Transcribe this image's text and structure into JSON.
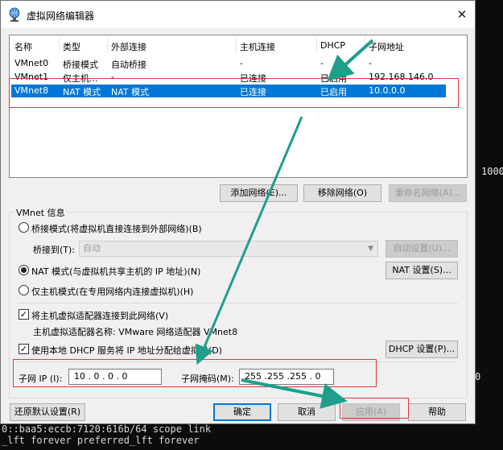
{
  "window": {
    "title": "虚拟网络编辑器",
    "close_glyph": "✕"
  },
  "columns": [
    "名称",
    "类型",
    "外部连接",
    "主机连接",
    "DHCP",
    "子网地址"
  ],
  "rows": [
    {
      "name": "VMnet0",
      "type": "桥接模式",
      "external": "自动桥接",
      "host": "-",
      "dhcp": "-",
      "subnet": "-"
    },
    {
      "name": "VMnet1",
      "type": "仅主机...",
      "external": "-",
      "host": "已连接",
      "dhcp": "已启用",
      "subnet": "192.168.146.0"
    },
    {
      "name": "VMnet8",
      "type": "NAT 模式",
      "external": "NAT 模式",
      "host": "已连接",
      "dhcp": "已启用",
      "subnet": "10.0.0.0"
    }
  ],
  "list_buttons": {
    "add": "添加网络(E)...",
    "remove": "移除网络(O)",
    "rename": "重命名网络(A)..."
  },
  "vmnet_info": {
    "group_label": "VMnet 信息",
    "bridged_radio": "桥接模式(将虚拟机直接连接到外部网络)(B)",
    "bridged_to_label": "桥接到(T):",
    "bridged_to_value": "自动",
    "auto_settings": "自动设置(U)...",
    "nat_radio": "NAT 模式(与虚拟机共享主机的 IP 地址)(N)",
    "nat_settings": "NAT 设置(S)...",
    "hostonly_radio": "仅主机模式(在专用网络内连接虚拟机)(H)",
    "connect_adapter_check": "将主机虚拟适配器连接到此网络(V)",
    "adapter_name": "主机虚拟适配器名称: VMware 网络适配器 VMnet8",
    "dhcp_check": "使用本地 DHCP 服务将 IP 地址分配给虚拟机(D)",
    "dhcp_settings": "DHCP 设置(P)...",
    "subnet_ip_label": "子网 IP (I):",
    "subnet_ip_value": "10 . 0 . 0 . 0",
    "subnet_mask_label": "子网掩码(M):",
    "subnet_mask_value": "255 .255 .255 . 0"
  },
  "footer": {
    "restore": "还原默认设置(R)",
    "ok": "确定",
    "cancel": "取消",
    "apply": "应用(A)",
    "help": "帮助"
  },
  "terminal": {
    "side_text_1": "1000",
    "side_text_2": "0",
    "line_1": "0::baa5:eccb:7120:616b/64 scope link",
    "line_2": "_lft forever preferred_lft forever"
  },
  "annotation_color": "#1f9e8c",
  "highlight_color": "#e0383c"
}
